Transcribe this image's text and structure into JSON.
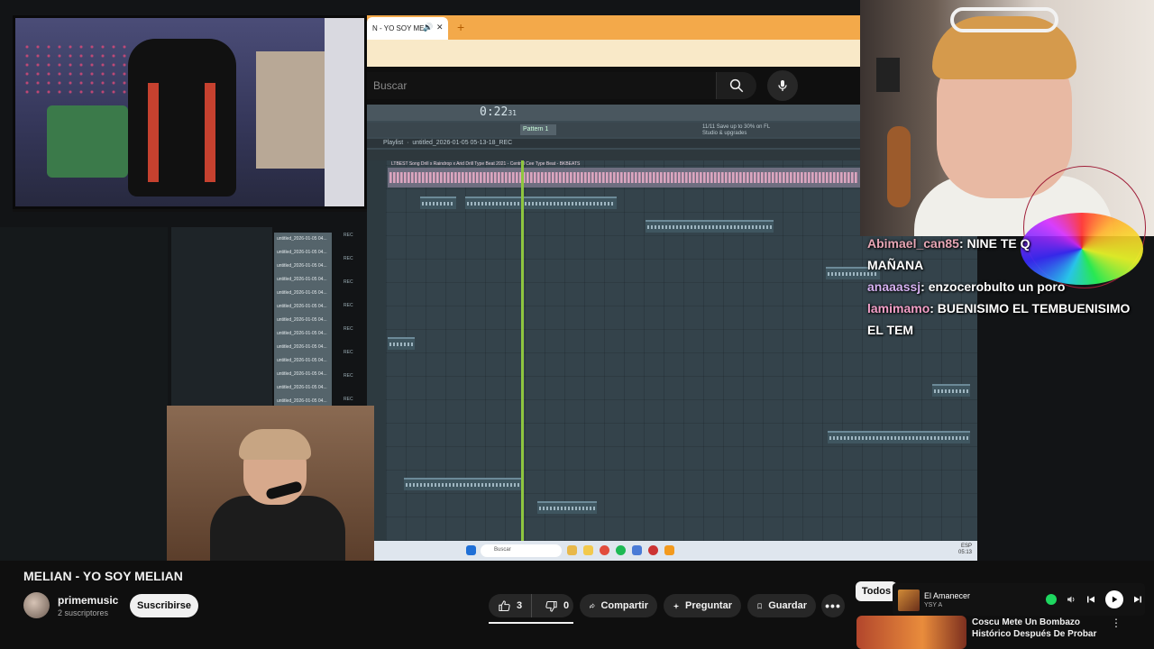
{
  "browser": {
    "tab_label": "N - YO SOY ME",
    "search_placeholder": "Buscar"
  },
  "daw": {
    "time": "0:22",
    "time_sub": "31",
    "pattern": "Pattern 1",
    "cpu_line1": "11/11 Save up to 30% on FL",
    "cpu_line2": "Studio & upgrades",
    "playlist_label": "Playlist",
    "playlist_file": "untitled_2026-01-05 05-13-18_REC",
    "main_track": "LTBEST Song Drill x Raindrop x Arid Drill Type Beat 2021 - Central Cee Type Beat - BKBEATS",
    "files": [
      "untitled_2026-01-05 04...",
      "untitled_2026-01-05 04...",
      "untitled_2026-01-05 04...",
      "untitled_2026-01-05 04...",
      "untitled_2026-01-05 04...",
      "untitled_2026-01-05 04...",
      "untitled_2026-01-05 04...",
      "untitled_2026-01-05 04...",
      "untitled_2026-01-05 04...",
      "untitled_2026-01-05 04...",
      "untitled_2026-01-05 04...",
      "untitled_2026-01-05 04...",
      "untitled_2026-01-05 04..."
    ],
    "rec_labels": [
      "REC",
      "REC",
      "REC",
      "REC",
      "REC",
      "REC",
      "REC",
      "REC"
    ]
  },
  "taskbar": {
    "search": "Buscar",
    "lang": "ESP",
    "clock": "05:13"
  },
  "chat": [
    {
      "user": "Abimael_can85",
      "msg": ": NINE TE Q",
      "cont": "MAÑANA"
    },
    {
      "user": "anaaassj",
      "msg": ": enzocerobulto un poro",
      "cont": ""
    },
    {
      "user": "lamimamo",
      "msg": ": BUENISIMO EL TEMBUENISIMO",
      "cont": "EL TEM"
    }
  ],
  "video": {
    "title": "MELIAN - YO SOY MELIAN",
    "channel": "primemusic",
    "subscribers": "2 suscriptores",
    "subscribe": "Suscribirse",
    "likes": "3",
    "dislikes": "0",
    "share": "Compartir",
    "ask": "Preguntar",
    "save": "Guardar"
  },
  "chips": {
    "all": "Todos"
  },
  "mini_player": {
    "title": "El Amanecer",
    "artist": "YSY A",
    "accent": "#1ed760"
  },
  "recommended": {
    "title": "Coscu Mete Un Bombazo Histórico Después De Probar"
  },
  "icons": {
    "search": "search-icon",
    "mic": "mic-icon",
    "like": "thumbs-up-icon",
    "dislike": "thumbs-down-icon",
    "share": "share-arrow-icon",
    "ask": "sparkle-icon",
    "save": "bookmark-icon",
    "more": "more-horizontal-icon"
  }
}
